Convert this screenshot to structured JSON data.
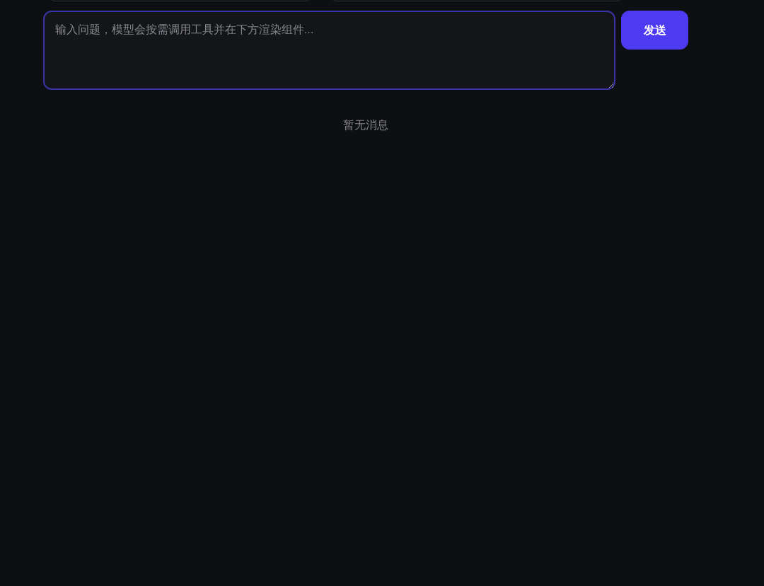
{
  "composer": {
    "placeholder": "输入问题，模型会按需调用工具并在下方渲染组件...",
    "focused": true,
    "send_button": "发送"
  },
  "messages": {
    "empty_text": "暂无消息"
  }
}
